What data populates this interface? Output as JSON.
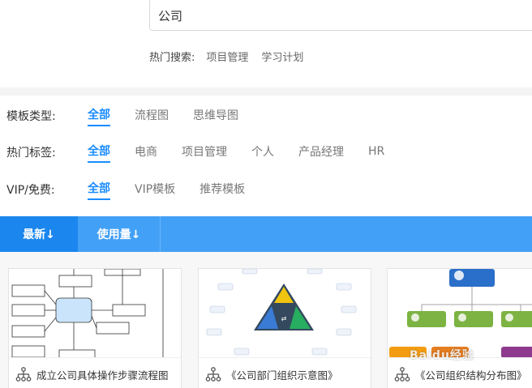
{
  "search": {
    "value": "公司",
    "hot_label": "热门搜索:",
    "hot_links": [
      "项目管理",
      "学习计划"
    ]
  },
  "filters": {
    "type": {
      "label": "模板类型:",
      "options": [
        "全部",
        "流程图",
        "思维导图"
      ],
      "active": 0
    },
    "tags": {
      "label": "热门标签:",
      "options": [
        "全部",
        "电商",
        "项目管理",
        "个人",
        "产品经理",
        "HR"
      ],
      "active": 0
    },
    "vip": {
      "label": "VIP/免费:",
      "options": [
        "全部",
        "VIP模板",
        "推荐模板"
      ],
      "active": 0
    }
  },
  "sort": {
    "latest": "最新↓",
    "usage": "使用量↓"
  },
  "cards": [
    {
      "title": "成立公司具体操作步骤流程图"
    },
    {
      "title": "《公司部门组织示意图》"
    },
    {
      "title": "《公司组织结构分布图》"
    }
  ],
  "colors": {
    "accent": "#1a8cff",
    "sort_bar": "#42a0f6",
    "sort_active": "#1b86ee"
  },
  "watermark": "Baidu经验"
}
